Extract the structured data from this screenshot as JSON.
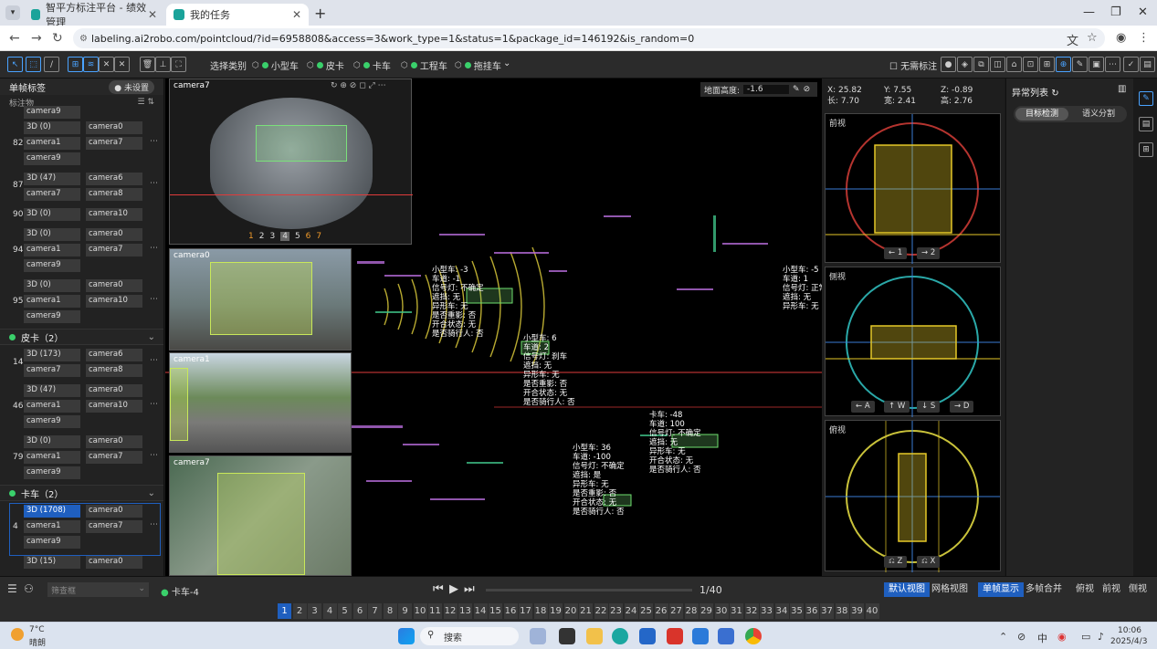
{
  "browser": {
    "tabs": [
      {
        "title": "智平方标注平台 - 绩效管理",
        "active": false
      },
      {
        "title": "我的任务",
        "active": true
      }
    ],
    "url": "labeling.ai2robo.com/pointcloud/?id=6958808&access=3&work_type=1&status=1&package_id=146192&is_random=0"
  },
  "appbar": {
    "select_category": "选择类别",
    "categories": [
      "小型车",
      "皮卡",
      "卡车",
      "工程车",
      "拖挂车"
    ],
    "no_dup": "无需标注"
  },
  "left_panel": {
    "title": "单帧标签",
    "badge": "未设置",
    "subhead": "标注物",
    "truncated_top": "camera9",
    "groups_top_rows": [
      {
        "num": "82",
        "chips": [
          [
            "3D (0)",
            "camera0"
          ],
          [
            "camera1",
            "camera7"
          ],
          [
            "camera9",
            ""
          ]
        ]
      },
      {
        "num": "87",
        "chips": [
          [
            "3D (47)",
            "camera6"
          ],
          [
            "camera7",
            "camera8"
          ]
        ]
      },
      {
        "num": "90",
        "chips": [
          [
            "3D (0)",
            "camera10"
          ]
        ]
      },
      {
        "num": "94",
        "chips": [
          [
            "3D (0)",
            "camera0"
          ],
          [
            "camera1",
            "camera7"
          ],
          [
            "camera9",
            ""
          ]
        ]
      },
      {
        "num": "95",
        "chips": [
          [
            "3D (0)",
            "camera0"
          ],
          [
            "camera1",
            "camera10"
          ],
          [
            "camera9",
            ""
          ]
        ]
      }
    ],
    "group_pickup": {
      "title": "皮卡（2）",
      "rows": [
        {
          "num": "14",
          "chips": [
            [
              "3D (173)",
              "camera6"
            ],
            [
              "camera7",
              "camera8"
            ]
          ]
        },
        {
          "num": "46",
          "chips": [
            [
              "3D (47)",
              "camera0"
            ],
            [
              "camera1",
              "camera10"
            ],
            [
              "camera9",
              ""
            ]
          ]
        },
        {
          "num": "79",
          "chips": [
            [
              "3D (0)",
              "camera0"
            ],
            [
              "camera1",
              "camera7"
            ],
            [
              "camera9",
              ""
            ]
          ]
        }
      ]
    },
    "group_truck": {
      "title": "卡车（2）",
      "rows": [
        {
          "num": "4",
          "chips": [
            [
              "3D (1708)",
              "camera0"
            ],
            [
              "camera1",
              "camera7"
            ],
            [
              "camera9",
              ""
            ]
          ]
        },
        {
          "num": "",
          "chips": [
            [
              "3D (15)",
              "camera0"
            ]
          ]
        }
      ]
    }
  },
  "viewport": {
    "cam_main": "camera7",
    "cam_pages": [
      "1",
      "2",
      "3",
      "4",
      "5",
      "6",
      "7"
    ],
    "cam0": "camera0",
    "cam1": "camera1",
    "cam7b": "camera7",
    "ground_height_label": "地面高度:",
    "ground_height_value": "-1.6",
    "labels": [
      {
        "t": "小型车: 6\n车道: 2\n信号灯: 刹车\n遮挡: 无\n异形车: 无\n是否重影: 否\n开合状态: 无\n是否骑行人: 否"
      },
      {
        "t": "小型车: 36\n车道: -100\n信号灯: 不确定\n遮挡: 是\n异形车: 无\n是否重影: 否\n开合状态: 无\n是否骑行人: 否"
      },
      {
        "t": "小型车: -3\n车道: -1\n信号灯: 不确定\n遮挡: 无\n异形车: 无\n是否重影: 否\n开合状态: 无\n是否骑行人: 否"
      },
      {
        "t": "小型车: -5\n车道: 1\n信号灯: 正常\n遮挡: 无\n异形车: 无"
      },
      {
        "t": "卡车: -48\n车道: 100\n信号灯: 不确定\n遮挡: 无\n异形车: 无\n开合状态: 无\n是否骑行人: 否"
      }
    ]
  },
  "right_panel": {
    "coords": {
      "x": "X: 25.82",
      "y": "Y: 7.55",
      "z": "Z: -0.89",
      "l": "长: 7.70",
      "w": "宽: 2.41",
      "h": "高: 2.76"
    },
    "front": "前视",
    "front_keys": [
      "← 1",
      "→ 2"
    ],
    "side": "侧视",
    "side_keys": [
      "← A",
      "↑ W",
      "↓ S",
      "→ D"
    ],
    "top": "俯视",
    "top_keys": [
      "Z",
      "X"
    ]
  },
  "far_right": {
    "title": "异常列表",
    "tab_det": "目标检测",
    "tab_seg": "语义分割"
  },
  "bottom": {
    "filter_placeholder": "筛查框",
    "selected": "卡车-4",
    "frame": "1/40",
    "default_view": "默认视图",
    "grid_view": "网格视图",
    "single": "单帧显示",
    "multi": "多帧合并",
    "top": "俯视",
    "front": "前视",
    "side": "侧视",
    "pages": [
      "1",
      "2",
      "3",
      "4",
      "5",
      "6",
      "7",
      "8",
      "9",
      "10",
      "11",
      "12",
      "13",
      "14",
      "15",
      "16",
      "17",
      "18",
      "19",
      "20",
      "21",
      "22",
      "23",
      "24",
      "25",
      "26",
      "27",
      "28",
      "29",
      "30",
      "31",
      "32",
      "33",
      "34",
      "35",
      "36",
      "37",
      "38",
      "39",
      "40"
    ]
  },
  "taskbar": {
    "weather_temp": "7°C",
    "weather_desc": "晴朗",
    "search": "搜索",
    "ime": "中",
    "time": "10:06",
    "date": "2025/4/3"
  }
}
